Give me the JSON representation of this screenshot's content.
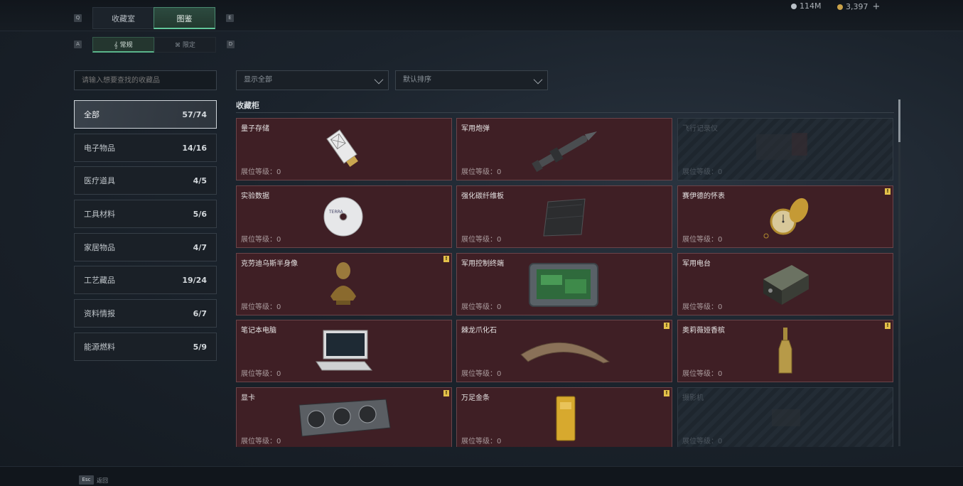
{
  "tabs": {
    "left_key": "Q",
    "right_key": "E",
    "items": [
      {
        "label": "收藏室",
        "active": false
      },
      {
        "label": "图鉴",
        "active": true
      }
    ]
  },
  "subtabs": {
    "left_key": "A",
    "right_key": "D",
    "items": [
      {
        "label": "常规",
        "icon": "music-note-icon",
        "active": true
      },
      {
        "label": "限定",
        "icon": "limited-icon",
        "active": false
      }
    ]
  },
  "currency": [
    {
      "icon": "silver-coin-icon",
      "value": "114M"
    },
    {
      "icon": "gold-coin-icon",
      "value": "3,397",
      "add": "+"
    }
  ],
  "search": {
    "placeholder": "请输入想要查找的收藏品"
  },
  "filters": {
    "display": "显示全部",
    "sort": "默认排序"
  },
  "categories": [
    {
      "label": "全部",
      "count": "57/74",
      "active": true
    },
    {
      "label": "电子物品",
      "count": "14/16"
    },
    {
      "label": "医疗道具",
      "count": "4/5"
    },
    {
      "label": "工具材料",
      "count": "5/6"
    },
    {
      "label": "家居物品",
      "count": "4/7"
    },
    {
      "label": "工艺藏品",
      "count": "19/24"
    },
    {
      "label": "资料情报",
      "count": "6/7"
    },
    {
      "label": "能源燃料",
      "count": "5/9"
    }
  ],
  "section_title": "收藏柜",
  "items": [
    {
      "name": "量子存储",
      "level": "展位等级：0",
      "icon": "quantum-storage-icon",
      "locked": false,
      "badge": false
    },
    {
      "name": "军用炮弹",
      "level": "展位等级：0",
      "icon": "artillery-shell-icon",
      "locked": false,
      "badge": false
    },
    {
      "name": "飞行记录仪",
      "level": "展位等级：0",
      "icon": "flight-recorder-icon",
      "locked": true,
      "badge": false
    },
    {
      "name": "实验数据",
      "level": "展位等级：0",
      "icon": "data-disc-icon",
      "locked": false,
      "badge": false
    },
    {
      "name": "强化碳纤维板",
      "level": "展位等级：0",
      "icon": "carbon-plate-icon",
      "locked": false,
      "badge": false
    },
    {
      "name": "赛伊德的怀表",
      "level": "展位等级：0",
      "icon": "pocket-watch-icon",
      "locked": false,
      "badge": true
    },
    {
      "name": "克劳迪乌斯半身像",
      "level": "展位等级：0",
      "icon": "bust-icon",
      "locked": false,
      "badge": true
    },
    {
      "name": "军用控制终端",
      "level": "展位等级：0",
      "icon": "control-terminal-icon",
      "locked": false,
      "badge": false
    },
    {
      "name": "军用电台",
      "level": "展位等级：0",
      "icon": "military-radio-icon",
      "locked": false,
      "badge": false
    },
    {
      "name": "笔记本电脑",
      "level": "展位等级：0",
      "icon": "laptop-icon",
      "locked": false,
      "badge": false
    },
    {
      "name": "棘龙爪化石",
      "level": "展位等级：0",
      "icon": "claw-fossil-icon",
      "locked": false,
      "badge": true
    },
    {
      "name": "奥莉薇娅香槟",
      "level": "展位等级：0",
      "icon": "champagne-icon",
      "locked": false,
      "badge": true
    },
    {
      "name": "显卡",
      "level": "展位等级：0",
      "icon": "graphics-card-icon",
      "locked": false,
      "badge": true
    },
    {
      "name": "万足金条",
      "level": "展位等级：0",
      "icon": "gold-bar-icon",
      "locked": false,
      "badge": true
    },
    {
      "name": "摄影机",
      "level": "展位等级：0",
      "icon": "camera-icon",
      "locked": true,
      "badge": false
    }
  ],
  "badge_glyph": "!",
  "footer": {
    "key": "Esc",
    "label": "返回"
  }
}
